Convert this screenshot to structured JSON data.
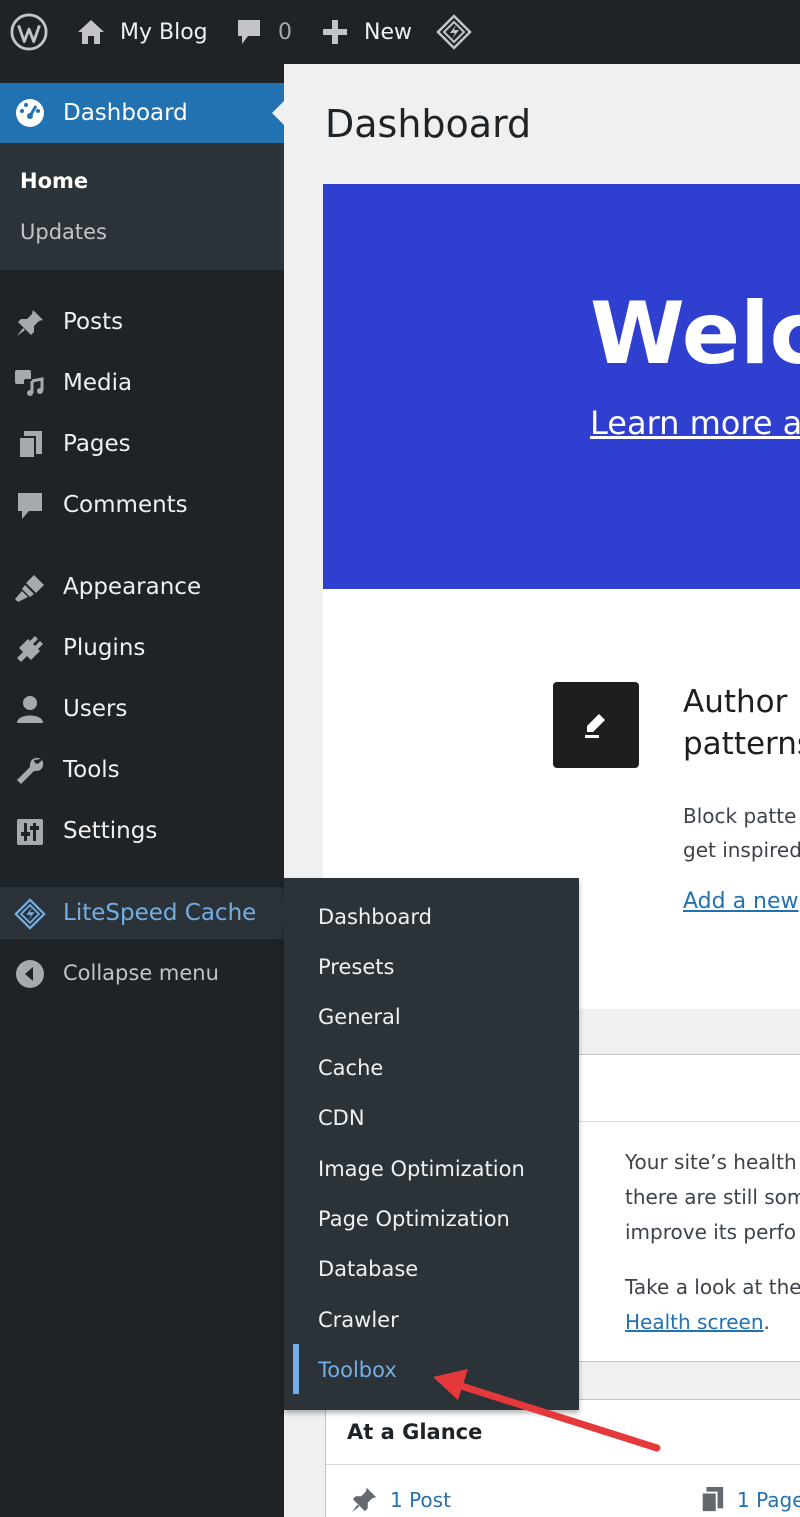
{
  "adminbar": {
    "site_name": "My Blog",
    "comments_count": "0",
    "new_label": "New"
  },
  "sidebar": {
    "dashboard_label": "Dashboard",
    "home_label": "Home",
    "updates_label": "Updates",
    "items": [
      {
        "label": "Posts",
        "icon": "pin-icon"
      },
      {
        "label": "Media",
        "icon": "media-icon"
      },
      {
        "label": "Pages",
        "icon": "pages-icon"
      },
      {
        "label": "Comments",
        "icon": "comment-icon"
      },
      {
        "label": "Appearance",
        "icon": "brush-icon"
      },
      {
        "label": "Plugins",
        "icon": "plug-icon"
      },
      {
        "label": "Users",
        "icon": "user-icon"
      },
      {
        "label": "Tools",
        "icon": "wrench-icon"
      },
      {
        "label": "Settings",
        "icon": "sliders-icon"
      }
    ],
    "litespeed_label": "LiteSpeed Cache",
    "collapse_label": "Collapse menu"
  },
  "flyout": {
    "items": [
      "Dashboard",
      "Presets",
      "General",
      "Cache",
      "CDN",
      "Image Optimization",
      "Page Optimization",
      "Database",
      "Crawler",
      "Toolbox"
    ],
    "active": "Toolbox"
  },
  "main": {
    "page_title": "Dashboard",
    "welcome_title": "Welco",
    "welcome_link": "Learn more al",
    "author_title_1": "Author",
    "author_title_2": "patterns",
    "author_desc_1": "Block patte",
    "author_desc_2": "get inspired",
    "author_link": "Add a new",
    "health_line_1": "Your site’s health",
    "health_line_2": "there are still som",
    "health_line_3": "improve its perfo",
    "health_line_4": "Take a look at the",
    "health_link": "Health screen",
    "health_link_suffix": ".",
    "glance_title": "At a Glance",
    "glance_posts": "1 Post",
    "glance_pages": "1 Page"
  },
  "colors": {
    "accent": "#2271b1",
    "welcome_bg": "#2f3fd0",
    "sidebar_bg": "#1d2327",
    "flyout_bg": "#2c3338",
    "active_link": "#72aee6",
    "arrow": "#e5383b"
  }
}
